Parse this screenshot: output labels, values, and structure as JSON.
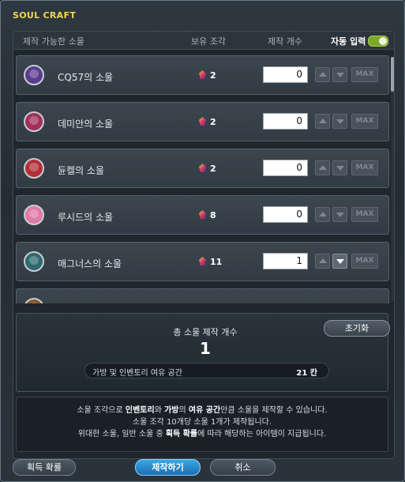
{
  "window": {
    "title": "SOUL CRAFT"
  },
  "header": {
    "col_soul": "제작 가능한 소울",
    "col_owned": "보유 조각",
    "col_count": "제작 개수",
    "auto_input_label": "자동 입력",
    "auto_input_on": true
  },
  "souls": [
    {
      "name": "CQ57의 소울",
      "fragments": "2",
      "quantity": "0",
      "avatar_color": "#5b3c8f"
    },
    {
      "name": "데미안의 소울",
      "fragments": "2",
      "quantity": "0",
      "avatar_color": "#a0305a"
    },
    {
      "name": "듄켈의 소울",
      "fragments": "2",
      "quantity": "0",
      "avatar_color": "#b2303a"
    },
    {
      "name": "루시드의 소울",
      "fragments": "8",
      "quantity": "0",
      "avatar_color": "#e07aa8"
    },
    {
      "name": "매그너스의 소울",
      "fragments": "11",
      "quantity": "1",
      "avatar_color": "#2f6a70"
    }
  ],
  "controls": {
    "max_label": "MAX"
  },
  "summary": {
    "total_label": "총 소울 제작 개수",
    "total_value": "1",
    "reset_label": "초기화",
    "space_label": "가방 및 인벤토리 여유 공간",
    "space_value": "21 칸"
  },
  "info": {
    "line1_a": "소울 조각으로 ",
    "line1_b": "인벤토리",
    "line1_c": "와 ",
    "line1_d": "가방",
    "line1_e": "의 ",
    "line1_f": "여유 공간",
    "line1_g": "만큼 소울을 제작할 수 있습니다.",
    "line2": "소울 조각 10개당 소울 1개가 제작됩니다.",
    "line3_a": "위대한 소울, 일반 소울 중 ",
    "line3_b": "획득 확률",
    "line3_c": "에 따라 해당하는 아이템이 지급됩니다."
  },
  "buttons": {
    "rate": "획득 확률",
    "craft": "제작하기",
    "cancel": "취소"
  },
  "colors": {
    "title": "#f1d458",
    "toggle_on": "#7ca82a",
    "craft_button": "#2a8fd4"
  }
}
